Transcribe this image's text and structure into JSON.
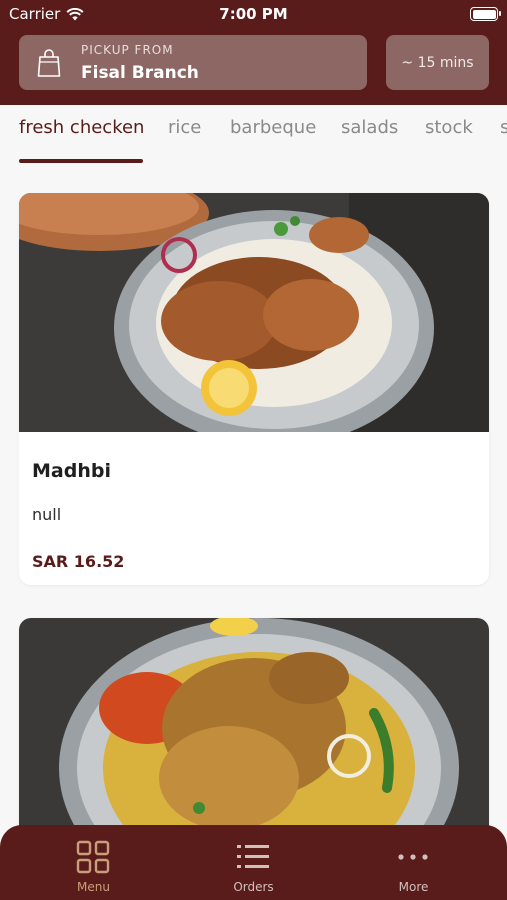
{
  "status_bar": {
    "carrier": "Carrier",
    "time": "7:00 PM"
  },
  "pickup": {
    "caption": "PICKUP FROM",
    "branch": "Fisal Branch",
    "eta": "~ 15 mins"
  },
  "categories": [
    {
      "label": "fresh checken",
      "active": true
    },
    {
      "label": "rice"
    },
    {
      "label": "barbeque"
    },
    {
      "label": "salads"
    },
    {
      "label": "stock"
    },
    {
      "label": "s"
    }
  ],
  "menu_items": [
    {
      "title": "Madhbi",
      "description": "null",
      "price": "SAR 16.52"
    }
  ],
  "bottom_nav": [
    {
      "label": "Menu",
      "icon": "grid-icon",
      "active": true
    },
    {
      "label": "Orders",
      "icon": "list-icon"
    },
    {
      "label": "More",
      "icon": "more-dots-icon"
    }
  ],
  "colors": {
    "brand": "#5a1c1a",
    "header_box": "#8c6764",
    "active_nav": "#c89f7a",
    "inactive_tab": "#8a8a8a"
  }
}
